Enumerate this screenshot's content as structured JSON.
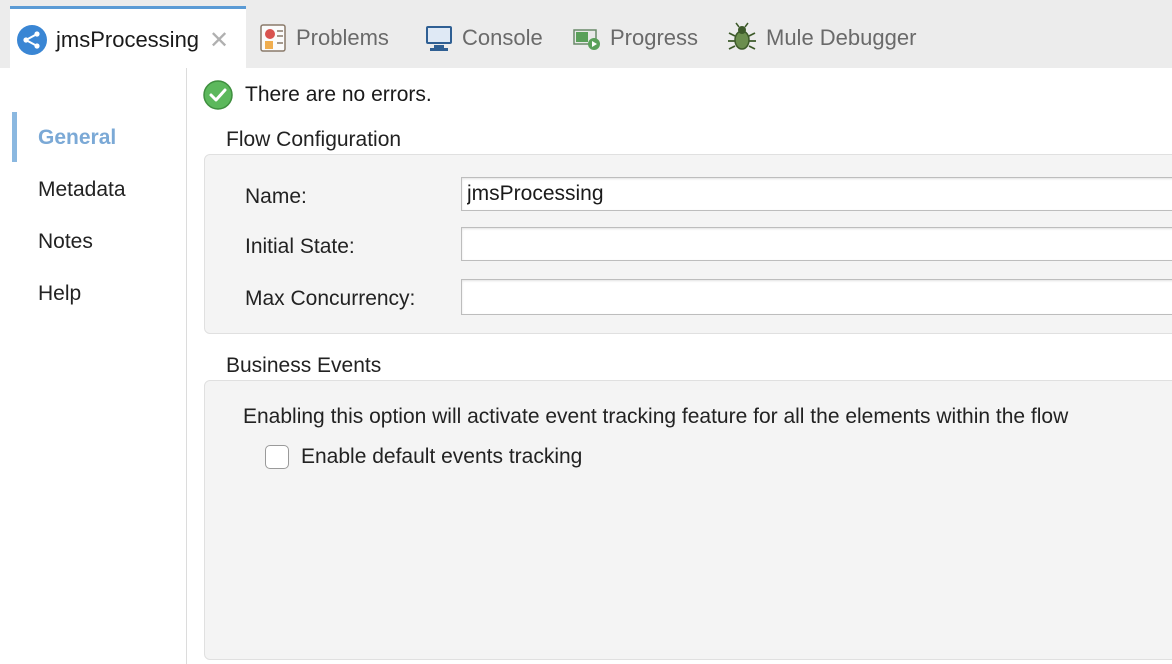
{
  "tabs": [
    {
      "label": "jmsProcessing",
      "active": true,
      "icon": "mule-flow-icon"
    },
    {
      "label": "Problems",
      "icon": "problems-icon"
    },
    {
      "label": "Console",
      "icon": "console-icon"
    },
    {
      "label": "Progress",
      "icon": "progress-icon"
    },
    {
      "label": "Mule Debugger",
      "icon": "bug-icon"
    }
  ],
  "nav": {
    "items": [
      {
        "label": "General",
        "selected": true
      },
      {
        "label": "Metadata"
      },
      {
        "label": "Notes"
      },
      {
        "label": "Help"
      }
    ]
  },
  "status": {
    "text": "There are no errors.",
    "icon": "success-check-icon"
  },
  "flow_config": {
    "title": "Flow Configuration",
    "fields": [
      {
        "label": "Name:",
        "value": "jmsProcessing"
      },
      {
        "label": "Initial State:",
        "value": ""
      },
      {
        "label": "Max Concurrency:",
        "value": ""
      }
    ]
  },
  "business_events": {
    "title": "Business Events",
    "description": "Enabling this option will activate event tracking feature for all the elements within the flow",
    "checkbox_label": "Enable default events tracking",
    "checked": false
  },
  "colors": {
    "accent": "#5b9bd5",
    "nav_selected": "#7ba9d6",
    "success": "#5cb85c"
  }
}
